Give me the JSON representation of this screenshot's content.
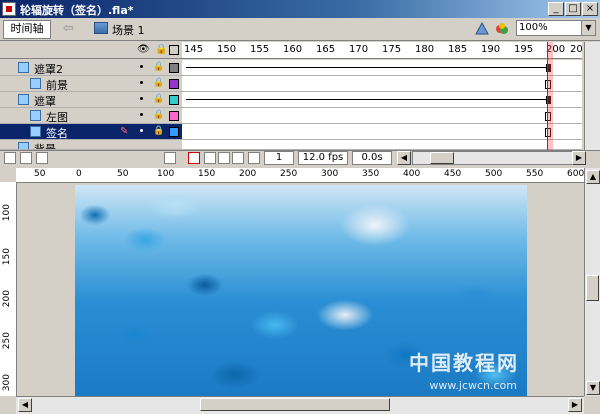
{
  "window": {
    "title": "轮辐旋转（签名）.fla*",
    "minimize": "_",
    "maximize": "□",
    "close": "×"
  },
  "toolbar": {
    "timeline_label": "时间轴",
    "back_arrow": "⇦",
    "scene_label": "场景 1",
    "zoom": "100%"
  },
  "timeline": {
    "frame_numbers": [
      "145",
      "150",
      "155",
      "160",
      "165",
      "170",
      "175",
      "180",
      "185",
      "190",
      "195",
      "200",
      "20"
    ],
    "layers": [
      {
        "name": "遮罩2",
        "color": "#808080",
        "selected": false
      },
      {
        "name": "前景",
        "color": "#9933cc",
        "selected": false
      },
      {
        "name": "遮罩",
        "color": "#33cccc",
        "selected": false
      },
      {
        "name": "左图",
        "color": "#ff66cc",
        "selected": false
      },
      {
        "name": "签名",
        "color": "#3399ff",
        "selected": true
      },
      {
        "name": "背景",
        "color": "#66cc33",
        "selected": false
      }
    ],
    "current_frame": "1",
    "fps": "12.0 fps",
    "elapsed": "0.0s"
  },
  "ruler_h": [
    "50",
    "0",
    "50",
    "100",
    "150",
    "200",
    "250",
    "300",
    "350",
    "400",
    "450",
    "500",
    "550",
    "600"
  ],
  "ruler_v": [
    "100",
    "150",
    "200",
    "250",
    "300"
  ],
  "watermark": {
    "text": "中国教程网",
    "url": "www.jcwcn.com"
  }
}
